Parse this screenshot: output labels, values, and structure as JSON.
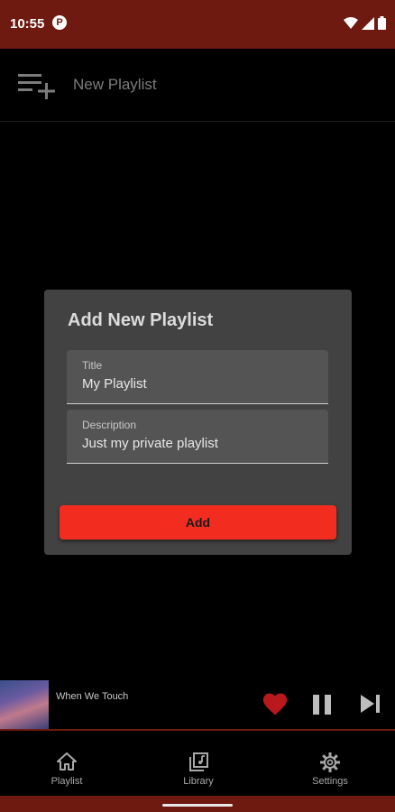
{
  "status": {
    "time": "10:55",
    "notif_glyph": "P"
  },
  "appbar": {
    "title": "New Playlist",
    "icon": "playlist-add-icon"
  },
  "dialog": {
    "title": "Add New Playlist",
    "fields": [
      {
        "label": "Title",
        "value": "My Playlist"
      },
      {
        "label": "Description",
        "value": "Just my private playlist"
      }
    ],
    "add_label": "Add"
  },
  "player": {
    "track": "When We Touch",
    "liked": true,
    "state": "playing"
  },
  "nav": {
    "items": [
      {
        "label": "Playlist",
        "icon": "home-icon"
      },
      {
        "label": "Library",
        "icon": "library-icon"
      },
      {
        "label": "Settings",
        "icon": "gear-icon"
      }
    ]
  },
  "colors": {
    "brand": "#6e1a11",
    "accent": "#f22d20",
    "heart": "#b9181d"
  }
}
